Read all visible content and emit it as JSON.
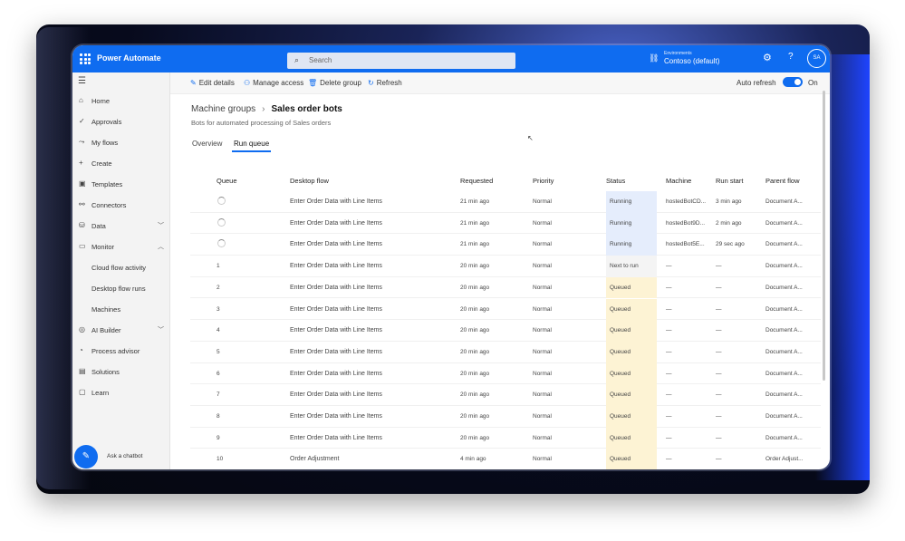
{
  "app": {
    "name": "Power Automate"
  },
  "search": {
    "placeholder": "Search"
  },
  "environment": {
    "label": "Environments",
    "name": "Contoso (default)"
  },
  "user": {
    "initials": "SA"
  },
  "sidebar": {
    "items": [
      {
        "label": "Home",
        "icon": "home-icon",
        "glyph": "⌂"
      },
      {
        "label": "Approvals",
        "icon": "approvals-icon",
        "glyph": "✓"
      },
      {
        "label": "My flows",
        "icon": "flows-icon",
        "glyph": "⤳"
      },
      {
        "label": "Create",
        "icon": "plus-icon",
        "glyph": "+"
      },
      {
        "label": "Templates",
        "icon": "templates-icon",
        "glyph": "▣"
      },
      {
        "label": "Connectors",
        "icon": "connectors-icon",
        "glyph": "⚯"
      },
      {
        "label": "Data",
        "icon": "data-icon",
        "glyph": "⛁"
      },
      {
        "label": "Monitor",
        "icon": "monitor-icon",
        "glyph": "▭"
      },
      {
        "label": "Cloud flow activity"
      },
      {
        "label": "Desktop flow runs"
      },
      {
        "label": "Machines"
      },
      {
        "label": "AI Builder",
        "icon": "ai-builder-icon",
        "glyph": "◎"
      },
      {
        "label": "Process advisor",
        "icon": "process-advisor-icon",
        "glyph": "◔"
      },
      {
        "label": "Solutions",
        "icon": "solutions-icon",
        "glyph": "▤"
      },
      {
        "label": "Learn",
        "icon": "learn-icon",
        "glyph": "▢"
      }
    ],
    "chatbot_label": "Ask a chatbot"
  },
  "toolbar": {
    "edit": "Edit details",
    "manage": "Manage access",
    "delete": "Delete group",
    "refresh": "Refresh",
    "auto_refresh": "Auto refresh",
    "toggle_state": "On"
  },
  "breadcrumb": {
    "parent": "Machine groups",
    "current": "Sales order bots"
  },
  "description": "Bots for automated processing of Sales orders",
  "tabs": [
    {
      "label": "Overview"
    },
    {
      "label": "Run queue"
    }
  ],
  "table": {
    "headers": [
      "Queue",
      "Desktop flow",
      "Requested",
      "Priority",
      "Status",
      "Machine",
      "Run start",
      "Parent flow"
    ],
    "rows": [
      {
        "queue": "",
        "flow": "Enter Order Data with Line Items",
        "requested": "21 min ago",
        "priority": "Normal",
        "status": "Running",
        "machine": "hostedBotCD...",
        "start": "3 min ago",
        "parent": "Document A..."
      },
      {
        "queue": "",
        "flow": "Enter Order Data with Line Items",
        "requested": "21 min ago",
        "priority": "Normal",
        "status": "Running",
        "machine": "hostedBot9D...",
        "start": "2 min ago",
        "parent": "Document A..."
      },
      {
        "queue": "",
        "flow": "Enter Order Data with Line Items",
        "requested": "21 min ago",
        "priority": "Normal",
        "status": "Running",
        "machine": "hostedBot5E...",
        "start": "29 sec ago",
        "parent": "Document A..."
      },
      {
        "queue": "1",
        "flow": "Enter Order Data with Line Items",
        "requested": "20 min ago",
        "priority": "Normal",
        "status": "Next to run",
        "machine": "—",
        "start": "—",
        "parent": "Document A..."
      },
      {
        "queue": "2",
        "flow": "Enter Order Data with Line Items",
        "requested": "20 min ago",
        "priority": "Normal",
        "status": "Queued",
        "machine": "—",
        "start": "—",
        "parent": "Document A..."
      },
      {
        "queue": "3",
        "flow": "Enter Order Data with Line Items",
        "requested": "20 min ago",
        "priority": "Normal",
        "status": "Queued",
        "machine": "—",
        "start": "—",
        "parent": "Document A..."
      },
      {
        "queue": "4",
        "flow": "Enter Order Data with Line Items",
        "requested": "20 min ago",
        "priority": "Normal",
        "status": "Queued",
        "machine": "—",
        "start": "—",
        "parent": "Document A..."
      },
      {
        "queue": "5",
        "flow": "Enter Order Data with Line Items",
        "requested": "20 min ago",
        "priority": "Normal",
        "status": "Queued",
        "machine": "—",
        "start": "—",
        "parent": "Document A..."
      },
      {
        "queue": "6",
        "flow": "Enter Order Data with Line Items",
        "requested": "20 min ago",
        "priority": "Normal",
        "status": "Queued",
        "machine": "—",
        "start": "—",
        "parent": "Document A..."
      },
      {
        "queue": "7",
        "flow": "Enter Order Data with Line Items",
        "requested": "20 min ago",
        "priority": "Normal",
        "status": "Queued",
        "machine": "—",
        "start": "—",
        "parent": "Document A..."
      },
      {
        "queue": "8",
        "flow": "Enter Order Data with Line Items",
        "requested": "20 min ago",
        "priority": "Normal",
        "status": "Queued",
        "machine": "—",
        "start": "—",
        "parent": "Document A..."
      },
      {
        "queue": "9",
        "flow": "Enter Order Data with Line Items",
        "requested": "20 min ago",
        "priority": "Normal",
        "status": "Queued",
        "machine": "—",
        "start": "—",
        "parent": "Document A..."
      },
      {
        "queue": "10",
        "flow": "Order Adjustment",
        "requested": "4 min ago",
        "priority": "Normal",
        "status": "Queued",
        "machine": "—",
        "start": "—",
        "parent": "Order Adjust..."
      }
    ]
  },
  "colors": {
    "accent": "#0f6cf0",
    "running": "#e5edfc",
    "queued": "#fdf3d4"
  }
}
